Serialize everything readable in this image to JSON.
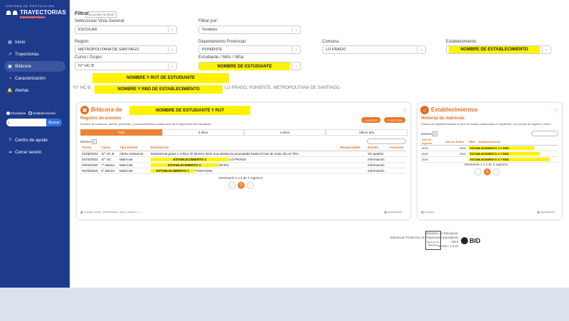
{
  "brand": {
    "top": "SISTEMA DE PROTECCIÓN",
    "name": "TRAYECTORIAS",
    "sub": "EDUCATIVAS"
  },
  "nav": [
    {
      "label": "Inicio",
      "icon": "home-icon",
      "glyph": "▤"
    },
    {
      "label": "Trayectorias",
      "icon": "route-icon",
      "glyph": "↗"
    },
    {
      "label": "Bitácora",
      "icon": "book-icon",
      "glyph": "▣"
    },
    {
      "label": "Caracterización",
      "icon": "chart-icon",
      "glyph": "◔"
    },
    {
      "label": "Alertas",
      "icon": "bell-icon",
      "glyph": "🔔"
    }
  ],
  "radios": {
    "student": "Estudiante",
    "school": "Establecimiento"
  },
  "search": {
    "placeholder": "",
    "button": "Buscar"
  },
  "nav_bottom": [
    {
      "label": "Centro de ayuda",
      "icon": "help-icon",
      "glyph": "?"
    },
    {
      "label": "Cerrar sesión",
      "icon": "logout-icon",
      "glyph": "⇥"
    }
  ],
  "filters": {
    "title": "Filtrar",
    "hide_button": "OCULTAR FILTROS",
    "vista_label": "Seleccionar Vista General:",
    "vista_value": "ESCOLAR",
    "filtrar_label": "Filtrar por:",
    "filtrar_value": "Territorio",
    "region_label": "Región:",
    "region_value": "METROPOLITANA DE SANTIAGO",
    "depto_label": "Departamento Provincial:",
    "depto_value": "PONIENTE",
    "comuna_label": "Comuna:",
    "comuna_value": "LO PRADO",
    "estab_label": "Establecimiento:",
    "estab_value": "NOMBRE DE ESTABLECIMIENTO",
    "curso_label": "Curso / Grupo:",
    "curso_value": "IV° HC B",
    "estud_label": "Estudiante / Niño / Niña:",
    "estud_value": "NOMBRE DE ESTUDIANTE"
  },
  "student_rut": "NOMBRE Y RUT DE ESTUDIANTE",
  "crumb": {
    "course": "IV° HC B,",
    "school": "NOMBRE Y RBD DE ESTABLECIMIENTO",
    "location": "LO PRADO, PONIENTE, METROPOLITANA DE SANTIAGO"
  },
  "bitacora": {
    "title": "Bitácora de",
    "student": "NOMBRE DE ESTUDIANTE Y RUT",
    "subtitle": "Registro de eventos",
    "desc": "Eventos de matrícula, alertas, gestiones, y acontecimientos académicos de la trayectoria del estudiante.",
    "btn_alert": "+ ALERTA",
    "btn_gestion": "+ GESTIÓN",
    "tabs": [
      "Todo",
      "5 años",
      "4 años",
      "Último año"
    ],
    "show_label": "Mostrar",
    "show_value": "5",
    "headers": [
      "Fecha",
      "Curso",
      "Tipo Evento",
      "Descripción",
      "Responsable",
      "Estado",
      "Acciones"
    ],
    "rows": [
      {
        "fecha": "31/05/2023",
        "curso": "IV° HC B",
        "tipo": "Alerta Asistencia",
        "desc": "Inasistencia grave o crítica: El alumno tiene una asistencia acumulada hasta el mes de Junio de un 76%.",
        "extra": "",
        "resp": "",
        "estado": "Sin gestión"
      },
      {
        "fecha": "01/03/2023",
        "curso": "IV° HC",
        "tipo": "Matrícula",
        "desc": "ESTABLECIMIENTO 3",
        "extra": "LO PRADO",
        "resp": "",
        "estado": "Información"
      },
      {
        "fecha": "02/03/2020",
        "curso": "7° Básico",
        "tipo": "Matrícula",
        "desc": "ESTABLECIMIENTO 2",
        "extra": "MAIPÚ",
        "resp": "",
        "estado": "Información"
      },
      {
        "fecha": "01/03/2019",
        "curso": "6° Básico",
        "tipo": "Matrícula",
        "desc": "ESTABLECIMIENTO 1",
        "extra": "PUDAHUEL",
        "resp": "",
        "estado": "Información"
      }
    ],
    "showing": "Mostrando 1 a 4 de 4 registros",
    "page": "1",
    "source": "Fuente: SIGE, GESPARVU, JEA, CENUC, J...",
    "date": "05/06/2023"
  },
  "estab": {
    "title": "Establecimientos",
    "subtitle": "Historial de matrícula",
    "desc": "Listado de establecimientos en que ha estado matriculado el estudiante, con su año de ingreso y retiro.",
    "show_label": "Mostrar",
    "show_value": "5",
    "headers": [
      "Año de Ingreso",
      "Año de Retiro",
      "RBD",
      "Establecimiento"
    ],
    "rows": [
      {
        "ingreso": "2019",
        "retiro": "2020",
        "name": "ESTABLECIMIENTO 1 Y RBD"
      },
      {
        "ingreso": "2020",
        "retiro": "2021",
        "name": "ESTABLECIMIENTO 2 Y RBD"
      },
      {
        "ingreso": "2023",
        "retiro": "",
        "name": "ESTABLECIMIENTO 3 Y RBD"
      }
    ],
    "showing": "Mostrando 1 a 3 de 3 registros",
    "page": "1",
    "source": "Fuente: -",
    "date": "05/06/2023"
  },
  "footer": {
    "line1": "Ministerio de Educación",
    "line2": "Sistema de Protección de Trayectorias Educativas",
    "year": "2023",
    "version": "Versión: 1.3.23",
    "bid": "BID",
    "gob": "Ministerio de Educación"
  }
}
